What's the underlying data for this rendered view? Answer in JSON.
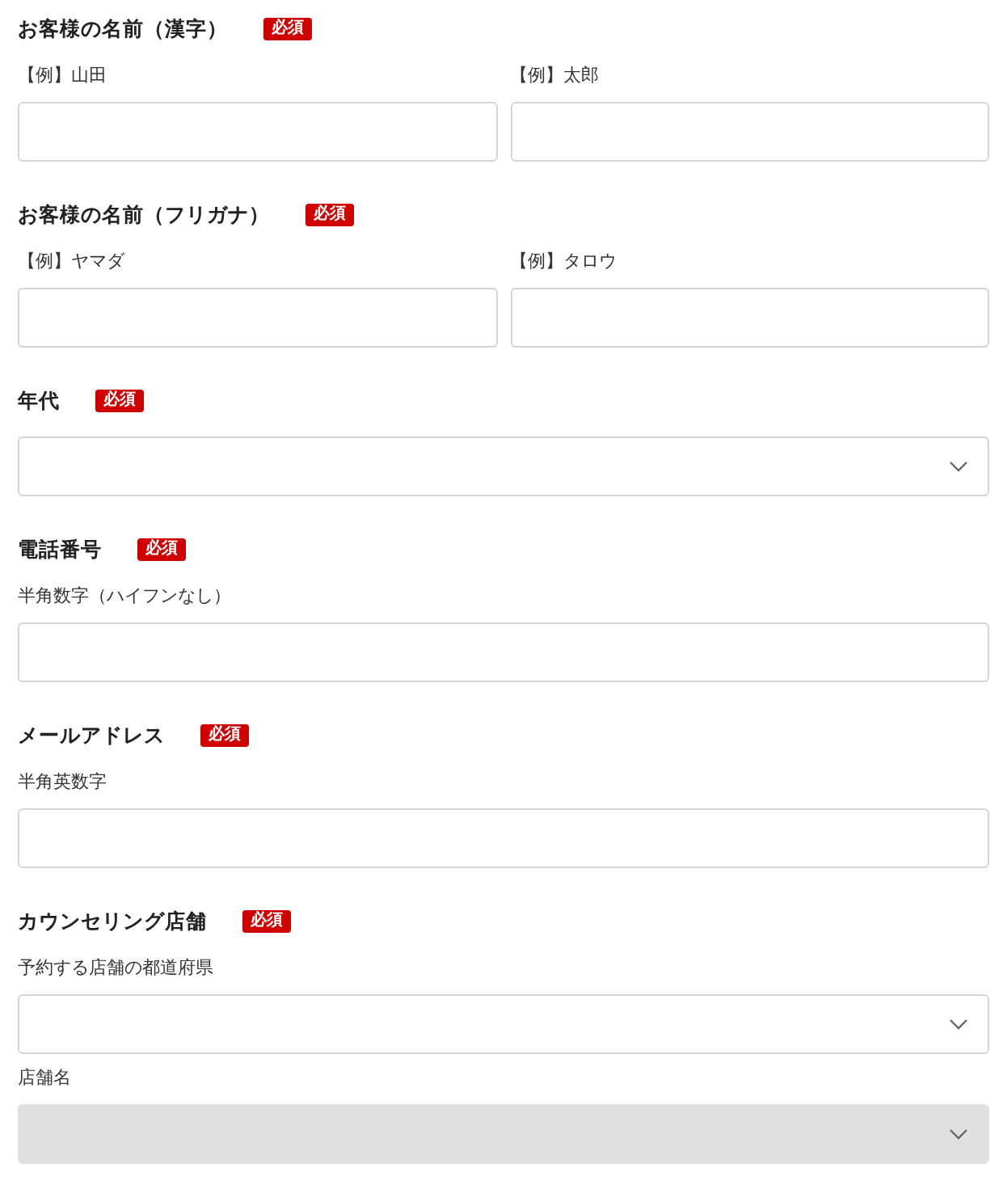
{
  "sections": [
    {
      "title": "お客様の名前（漢字）",
      "required_badge": "必須",
      "kind": "pair",
      "fields": [
        {
          "kind": "text",
          "hint": "【例】山田"
        },
        {
          "kind": "text",
          "hint": "【例】太郎"
        }
      ]
    },
    {
      "title": "お客様の名前（フリガナ）",
      "required_badge": "必須",
      "kind": "pair",
      "fields": [
        {
          "kind": "text",
          "hint": "【例】ヤマダ"
        },
        {
          "kind": "text",
          "hint": "【例】タロウ"
        }
      ]
    },
    {
      "title": "年代",
      "required_badge": "必須",
      "kind": "stack",
      "fields": [
        {
          "kind": "select",
          "disabled": false
        }
      ]
    },
    {
      "title": "電話番号",
      "required_badge": "必須",
      "kind": "stack",
      "fields": [
        {
          "kind": "text",
          "hint": "半角数字（ハイフンなし）"
        }
      ]
    },
    {
      "title": "メールアドレス",
      "required_badge": "必須",
      "kind": "stack",
      "fields": [
        {
          "kind": "text",
          "hint": "半角英数字"
        }
      ]
    },
    {
      "title": "カウンセリング店舗",
      "required_badge": "必須",
      "kind": "stack",
      "fields": [
        {
          "kind": "select",
          "hint": "予約する店舗の都道府県",
          "disabled": false
        },
        {
          "kind": "select",
          "hint": "店舗名",
          "disabled": true
        }
      ]
    }
  ]
}
